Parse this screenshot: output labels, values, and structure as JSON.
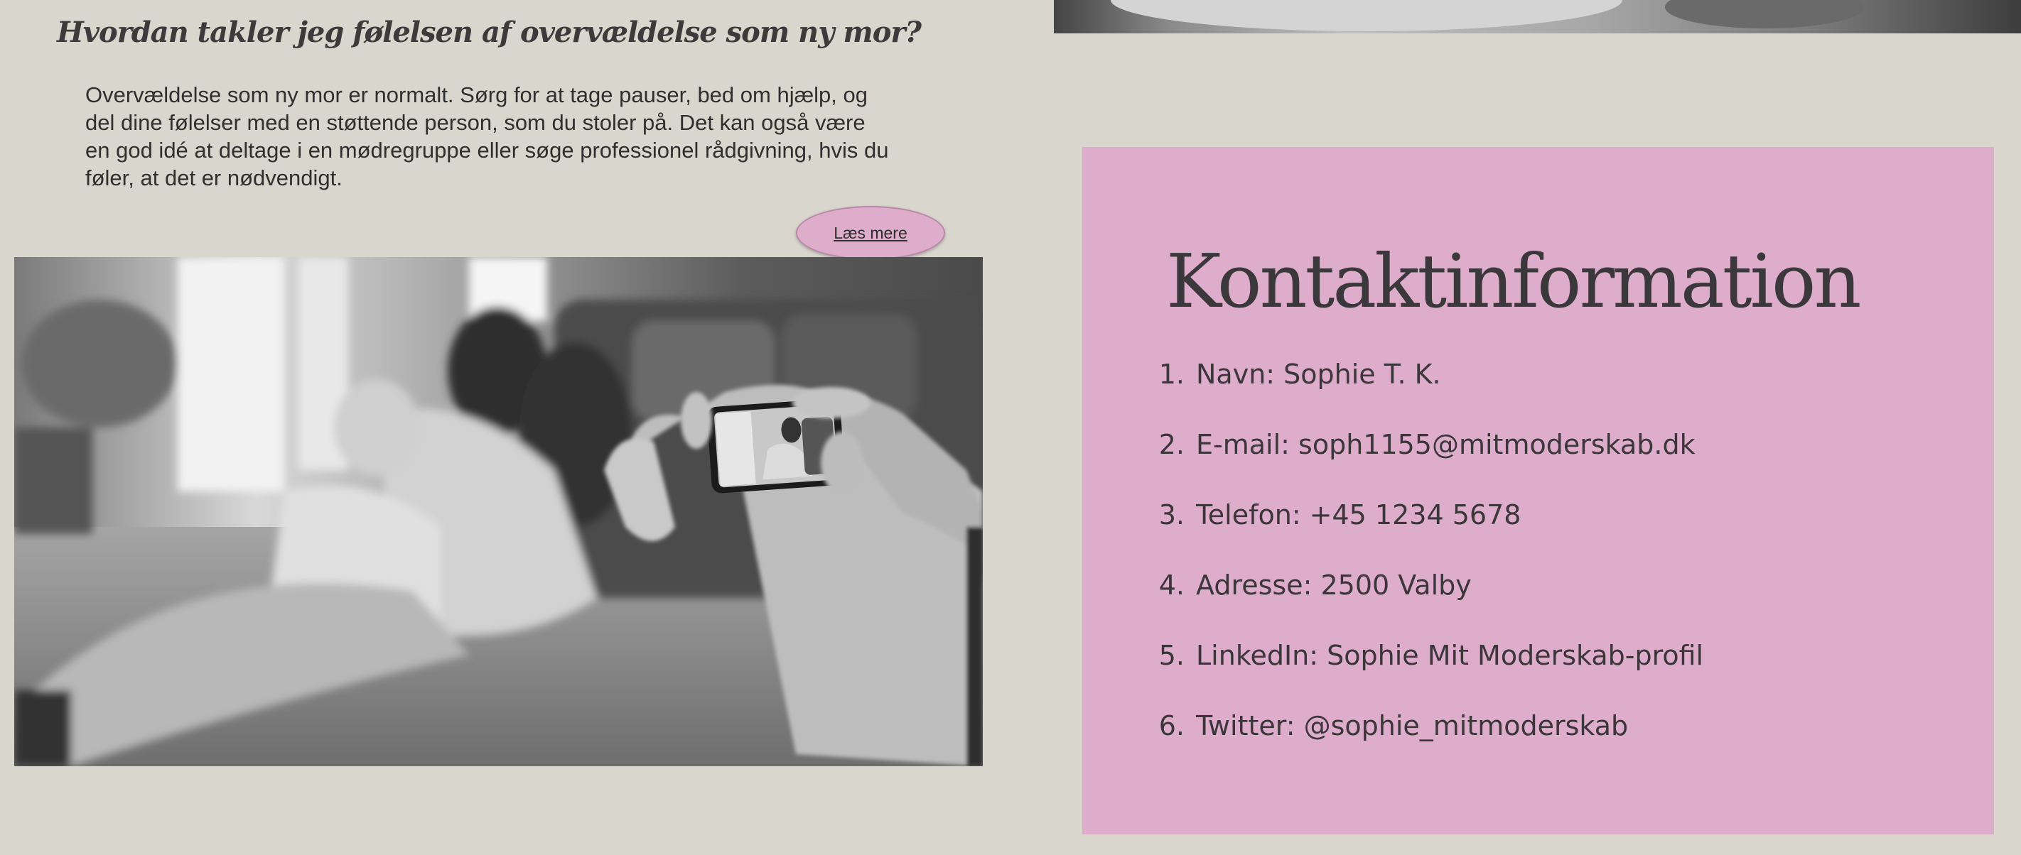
{
  "faq": {
    "question": "Hvordan takler jeg følelsen af overvældelse som ny mor?",
    "answer": "Overvældelse som ny mor er normalt. Sørg for at tage pauser, bed om hjælp, og del dine følelser med en støttende person, som du stoler på. Det kan også være en god idé at deltage i en mødregruppe eller søge professionel rådgivning, hvis du føler, at det er nødvendigt.",
    "read_more_label": "Læs mere"
  },
  "contact": {
    "title": "Kontaktinformation",
    "items": [
      {
        "number": "1.",
        "text": "Navn: Sophie T. K."
      },
      {
        "number": "2.",
        "text": "E-mail: soph1155@mitmoderskab.dk"
      },
      {
        "number": "3.",
        "text": "Telefon: +45 1234 5678"
      },
      {
        "number": "4.",
        "text": "Adresse: 2500 Valby"
      },
      {
        "number": "5.",
        "text": "LinkedIn: Sophie Mit Moderskab-profil"
      },
      {
        "number": "6.",
        "text": "Twitter: @sophie_mitmoderskab"
      }
    ]
  },
  "colors": {
    "page_background": "#d9d6cd",
    "card_background": "#deadcc",
    "button_background": "#deadcc",
    "text": "#3a3a3a"
  }
}
